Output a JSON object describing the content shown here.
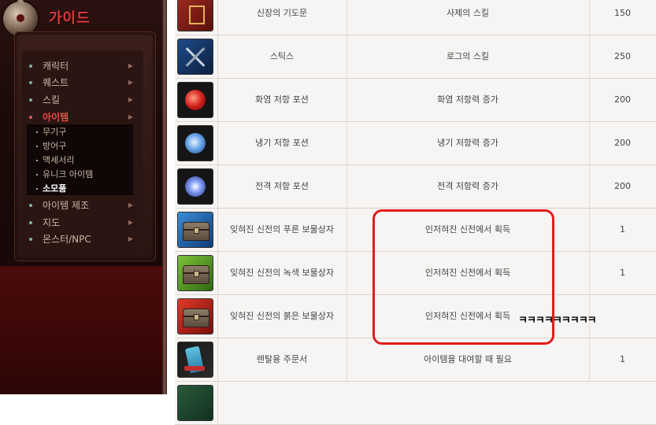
{
  "sidebar": {
    "title": "가이드",
    "menu": [
      {
        "label": "캐릭터",
        "active": false
      },
      {
        "label": "퀘스트",
        "active": false
      },
      {
        "label": "스킬",
        "active": false
      },
      {
        "label": "아이템",
        "active": true
      },
      {
        "label": "아이템 제조",
        "active": false
      },
      {
        "label": "지도",
        "active": false
      },
      {
        "label": "몬스터/NPC",
        "active": false
      }
    ],
    "submenu": [
      {
        "label": "무기구",
        "active": false
      },
      {
        "label": "방어구",
        "active": false
      },
      {
        "label": "액세서리",
        "active": false
      },
      {
        "label": "유니크 아이템",
        "active": false
      },
      {
        "label": "소모품",
        "active": true
      }
    ],
    "arrow_glyph": "▶"
  },
  "items": [
    {
      "icon": "red-book-icon",
      "name": "신장의 기도문",
      "desc": "사제의 스킬",
      "price": "150"
    },
    {
      "icon": "crossed-blades-icon",
      "name": "스틱스",
      "desc": "로그의 스킬",
      "price": "250"
    },
    {
      "icon": "fire-potion-icon",
      "name": "화염 저항 포션",
      "desc": "화염 저항력 증가",
      "price": "200"
    },
    {
      "icon": "cold-potion-icon",
      "name": "냉기 저항 포션",
      "desc": "냉기 저항력 증가",
      "price": "200"
    },
    {
      "icon": "lightning-potion-icon",
      "name": "전격 저항 포션",
      "desc": "전격 저항력 증가",
      "price": "200"
    },
    {
      "icon": "blue-treasure-chest-icon",
      "name": "잊혀진 신전의 푸른 보물상자",
      "desc": "인저혀진 신전에서 획득",
      "price": "1"
    },
    {
      "icon": "green-treasure-chest-icon",
      "name": "잊혀진 신전의 녹색 보물상자",
      "desc": "인저혀진 신전에서 획득",
      "price": "1"
    },
    {
      "icon": "red-treasure-chest-icon",
      "name": "잊혀진 신전의 붉은 보물상자",
      "desc": "인저혀진 신전에서 획득",
      "price": ""
    },
    {
      "icon": "rental-scroll-icon",
      "name": "렌탈용 주문서",
      "desc": "아이템을 대여할 때 필요",
      "price": "1"
    }
  ],
  "annotation": {
    "scribble_text": "ㅋㅋㅋㅋㅋㅋㅋㅋㅋ",
    "highlight_color": "#e41b1b"
  }
}
